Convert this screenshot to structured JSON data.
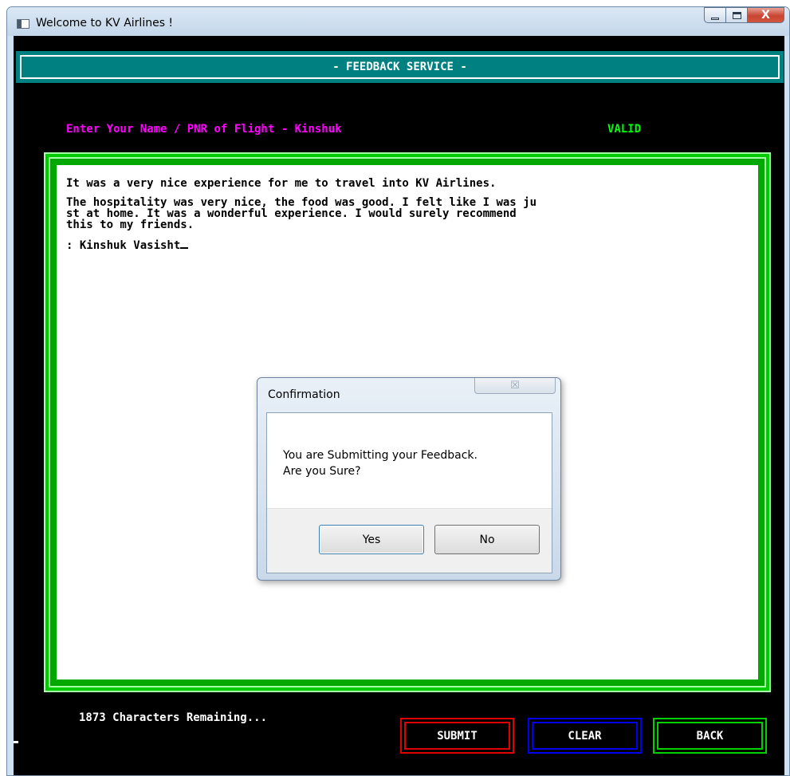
{
  "window": {
    "title": "Welcome to KV Airlines !",
    "controls": [
      "minimize-icon",
      "maximize-icon",
      "close-icon"
    ],
    "close_glyph": "X"
  },
  "console": {
    "header_title": "- FEEDBACK SERVICE -",
    "name_label": "Enter Your Name / PNR of Flight - Kinshuk",
    "valid_status": "VALID",
    "feedback_paragraphs": [
      "It was a very nice experience for me to travel into KV Airlines.",
      "The hospitality was very nice, the food was good. I felt like I was ju\nst at home. It was a wonderful experience. I would surely recommend\nthis to my friends.",
      ": Kinshuk Vasisht"
    ],
    "chars_remaining": "1873 Characters Remaining...",
    "buttons": {
      "submit": "SUBMIT",
      "clear": "CLEAR",
      "back": "BACK"
    },
    "colors": {
      "background": "#000000",
      "header": "#008080",
      "name_label": "#ff00ff",
      "valid": "#00ff00",
      "frame": "#00cc00",
      "submit": "#e00000",
      "clear": "#0000ee",
      "back": "#00d000"
    }
  },
  "dialog": {
    "title": "Confirmation",
    "close_glyph": "☒",
    "message_line1": "You are Submitting your Feedback.",
    "message_line2": "Are you Sure?",
    "yes_label": "Yes",
    "no_label": "No"
  }
}
